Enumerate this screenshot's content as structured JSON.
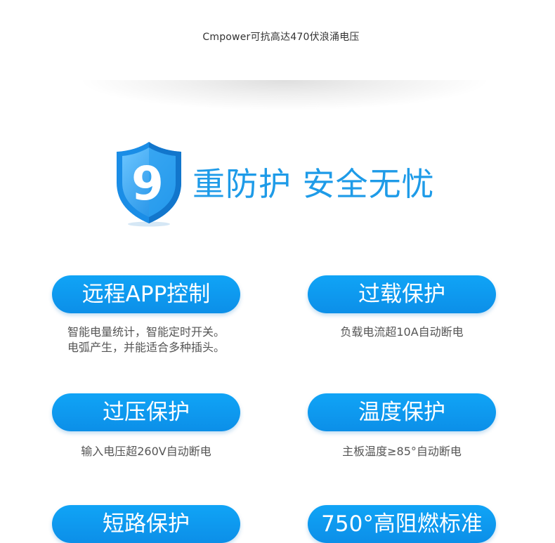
{
  "top_caption": "Cmpower可抗高达470伏浪涌电压",
  "headline": {
    "badge_number": "9",
    "text": "重防护 安全无忧"
  },
  "features": [
    {
      "title": "远程APP控制",
      "desc_lines": [
        "智能电量统计，智能定时开关。",
        "电弧产生，并能适合多种插头。"
      ]
    },
    {
      "title": "过载保护",
      "desc_lines": [
        "负载电流超10A自动断电"
      ]
    },
    {
      "title": "过压保护",
      "desc_lines": [
        "输入电压超260V自动断电"
      ]
    },
    {
      "title": "温度保护",
      "desc_lines": [
        "主板温度≥85°自动断电"
      ]
    },
    {
      "title": "短路保护",
      "desc_lines": []
    },
    {
      "title": "750°高阻燃标准",
      "desc_lines": []
    }
  ],
  "colors": {
    "accent_blue": "#1e9be8",
    "pill_blue": "#0c8fe8",
    "shield_light": "#8ed4ff",
    "shield_dark": "#1a8de6"
  },
  "icons": [
    "shield-icon"
  ]
}
